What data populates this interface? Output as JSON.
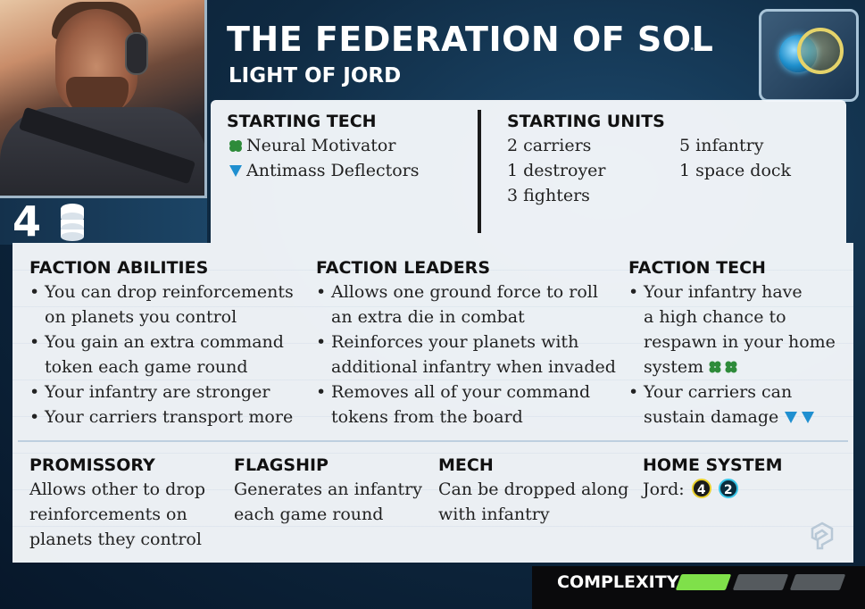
{
  "card": {
    "title": "THE FEDERATION OF SOL",
    "subtitle": "LIGHT OF JORD",
    "cost": "4",
    "icons": {
      "cost": "resource-stack-icon",
      "emblem": "faction-emblem-icon",
      "corner": "publisher-logo-icon"
    },
    "colors": {
      "green_tech": "#2e8b3a",
      "blue_tech": "#1f8fd0",
      "complexity_on": "#7fe04a",
      "complexity_off": "#555a5e"
    }
  },
  "starting_tech": {
    "heading": "STARTING TECH",
    "items": [
      {
        "icon": "biotic-tech-icon",
        "label": "Neural Motivator"
      },
      {
        "icon": "propulsion-tech-icon",
        "label": "Antimass Deflectors"
      }
    ]
  },
  "starting_units": {
    "heading": "STARTING UNITS",
    "col1": [
      "2 carriers",
      "1 destroyer",
      "3 fighters"
    ],
    "col2": [
      "5 infantry",
      "1 space dock"
    ]
  },
  "faction_abilities": {
    "heading": "FACTION ABILITIES",
    "lines": [
      "You can drop reinforcements",
      "on planets you control",
      "You gain an extra command",
      "token each game round",
      "Your infantry are stronger",
      "Your carriers transport more"
    ]
  },
  "faction_leaders": {
    "heading": "FACTION LEADERS",
    "lines": [
      "Allows one ground force to roll",
      "an extra die in combat",
      "Reinforces your planets with",
      "additional infantry when invaded",
      "Removes all of your command",
      "tokens from the board"
    ]
  },
  "faction_tech": {
    "heading": "FACTION TECH",
    "lines": [
      "Your infantry have",
      "a high chance to",
      "respawn in your home",
      "system",
      "Your carriers can",
      "sustain damage"
    ]
  },
  "promissory": {
    "heading": "PROMISSORY",
    "lines": [
      "Allows other to drop",
      "reinforcements on",
      "planets they control"
    ]
  },
  "flagship": {
    "heading": "FLAGSHIP",
    "lines": [
      "Generates an infantry",
      "each game round"
    ]
  },
  "mech": {
    "heading": "MECH",
    "lines": [
      "Can be dropped along",
      "with infantry"
    ]
  },
  "home_system": {
    "heading": "HOME SYSTEM",
    "planet": "Jord:",
    "resources": "4",
    "influence": "2"
  },
  "complexity": {
    "label": "COMPLEXITY",
    "level": 1,
    "max": 3
  }
}
